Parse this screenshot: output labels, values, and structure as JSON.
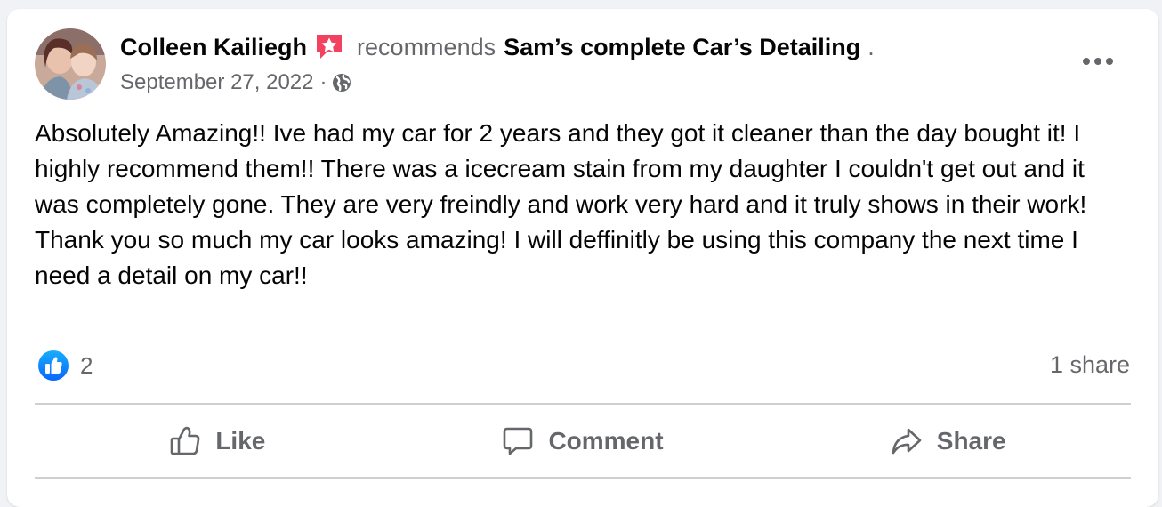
{
  "post": {
    "author": "Colleen Kailiegh",
    "action_text": "recommends",
    "page_name": "Sam’s complete Car’s Detailing",
    "trailing_period": ".",
    "date": "September 27, 2022",
    "separator": "·",
    "privacy_icon": "globe-icon",
    "badge_icon": "recommendation-star-icon",
    "more_icon": "more-options-icon",
    "body_paragraphs": [
      "Absolutely Amazing!! Ive had my car for 2 years and they got it cleaner than the day bought it! I highly recommend them!! There was a icecream stain from my daughter I couldn't get out and it was completely gone. They are very freindly and work very hard and it truly shows in their work!",
      "Thank you so much my car looks amazing! I will deffinitly be using this company the next time I need a detail on my car!!"
    ]
  },
  "engagement": {
    "reaction_icon": "like-reaction-icon",
    "reaction_count": "2",
    "share_count": "1 share"
  },
  "actions": {
    "like_label": "Like",
    "comment_label": "Comment",
    "share_label": "Share"
  },
  "colors": {
    "text_primary": "#050505",
    "text_secondary": "#65676b",
    "like_blue": "#1877f2",
    "badge_pink": "#f3425f",
    "divider": "#ced0d4",
    "background": "#f0f2f5",
    "card": "#ffffff"
  }
}
